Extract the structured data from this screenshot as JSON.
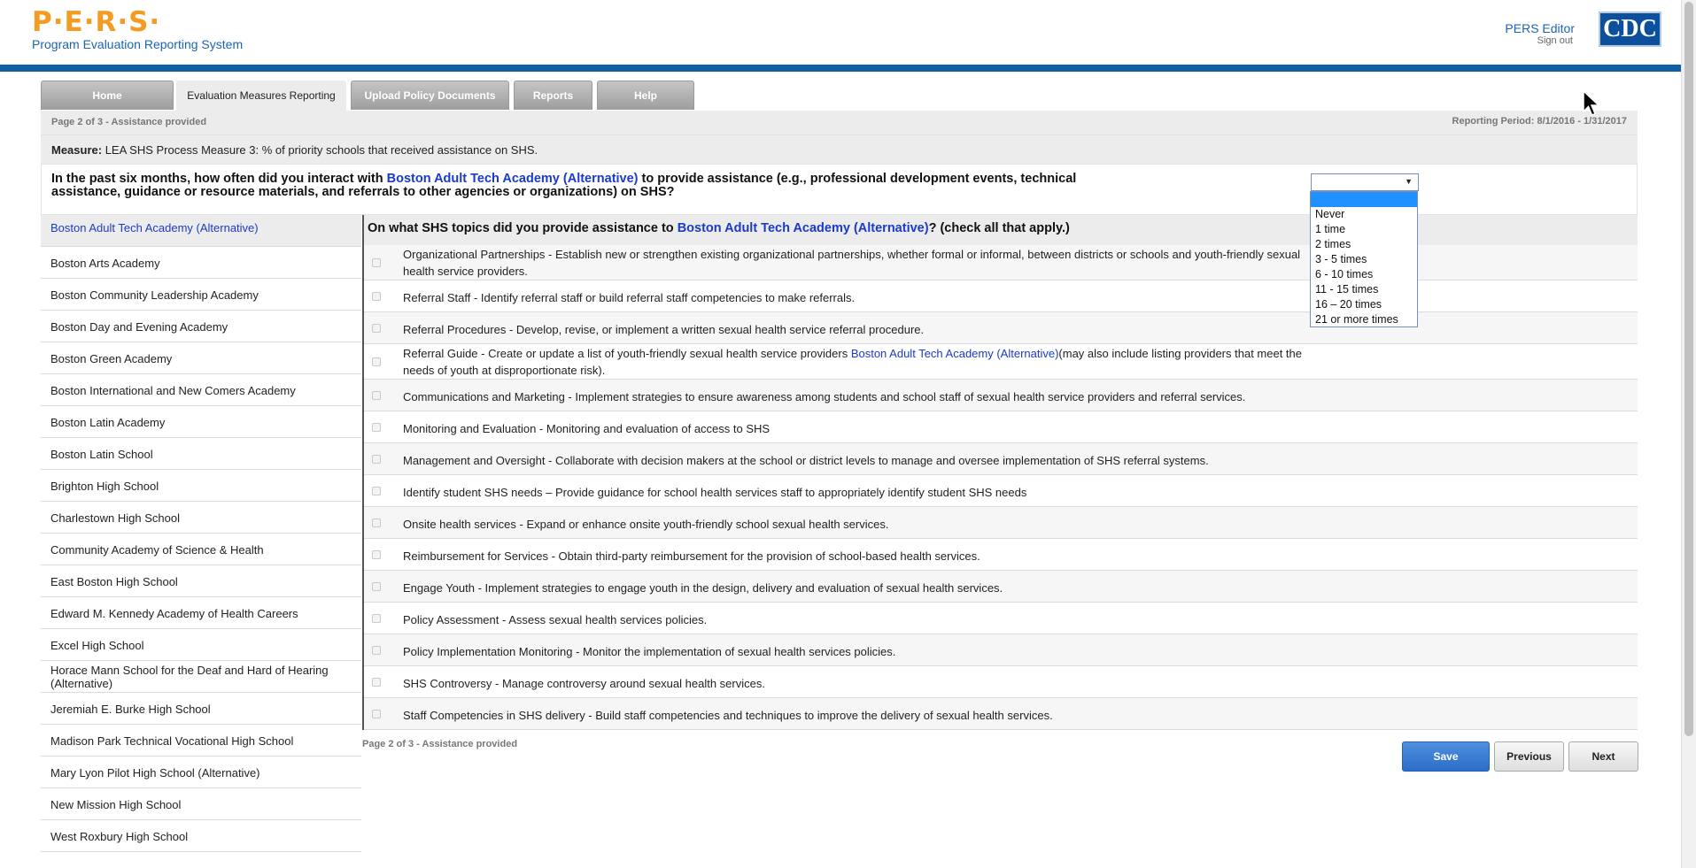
{
  "header": {
    "logo_letters": "P·E·R·S·",
    "logo_subtitle": "Program Evaluation Reporting System",
    "user_name": "PERS Editor",
    "sign_out": "Sign out",
    "cdc_logo_text": "CDC"
  },
  "tabs": [
    {
      "label": "Home"
    },
    {
      "label": "Evaluation Measures Reporting"
    },
    {
      "label": "Upload Policy Documents"
    },
    {
      "label": "Reports"
    },
    {
      "label": "Help"
    }
  ],
  "page_status": "Page 2 of 3 - Assistance provided",
  "reporting_period": "Reporting Period: 8/1/2016 - 1/31/2017",
  "measure": {
    "label": "Measure:",
    "text": "LEA SHS Process Measure 3: % of priority schools that received assistance on SHS."
  },
  "question": {
    "prefix": "In the past six months, how often did you interact with",
    "school": "Boston Adult Tech Academy (Alternative)",
    "suffix": "to provide assistance (e.g., professional development events, technical assistance, guidance or resource materials, and referrals to other agencies or organizations) on SHS?"
  },
  "frequency_select": {
    "selected": "",
    "options": [
      "",
      "Never",
      "1 time",
      "2 times",
      "3 - 5 times",
      "6 - 10 times",
      "11 - 15 times",
      "16 – 20 times",
      "21 or more times"
    ]
  },
  "schools": [
    "Boston Adult Tech Academy (Alternative)",
    "Boston Arts Academy",
    "Boston Community Leadership Academy",
    "Boston Day and Evening Academy",
    "Boston Green Academy",
    "Boston International and New Comers Academy",
    "Boston Latin Academy",
    "Boston Latin School",
    "Brighton High School",
    "Charlestown High School",
    "Community Academy of Science & Health",
    "East Boston High School",
    "Edward M. Kennedy Academy of Health Careers",
    "Excel High School",
    "Horace Mann School for the Deaf and Hard of Hearing (Alternative)",
    "Jeremiah E. Burke High School",
    "Madison Park Technical Vocational High School",
    "Mary Lyon Pilot High School (Alternative)",
    "New Mission High School",
    "West Roxbury High School"
  ],
  "topics_heading": {
    "prefix": "On what SHS topics did you provide assistance to",
    "school": "Boston Adult Tech Academy (Alternative)",
    "suffix": "? (check all that apply.)"
  },
  "topics": [
    {
      "text": "Organizational Partnerships - Establish new or strengthen existing organizational partnerships, whether formal or informal, between districts or schools and youth-friendly sexual health service providers."
    },
    {
      "text": "Referral Staff - Identify referral staff or build referral staff competencies to make referrals."
    },
    {
      "text": "Referral Procedures - Develop, revise, or implement a written sexual health service referral procedure."
    },
    {
      "text_before": "Referral Guide - Create or update a list of youth-friendly sexual health service providers ",
      "school": "Boston Adult Tech Academy (Alternative)",
      "text_after": "(may also include listing providers that meet the needs of youth at disproportionate risk)."
    },
    {
      "text": "Communications and Marketing - Implement strategies to ensure awareness among students and school staff of sexual health service providers and referral services."
    },
    {
      "text": "Monitoring and Evaluation - Monitoring and evaluation of access to SHS"
    },
    {
      "text": "Management and Oversight - Collaborate with decision makers at the school or district levels to manage and oversee implementation of SHS referral systems."
    },
    {
      "text": "Identify student SHS needs – Provide guidance for school health services staff to appropriately identify student SHS needs"
    },
    {
      "text": "Onsite health services - Expand or enhance onsite youth-friendly school sexual health services."
    },
    {
      "text": "Reimbursement for Services - Obtain third-party reimbursement for the provision of school-based health services."
    },
    {
      "text": "Engage Youth - Implement strategies to engage youth in the design, delivery and evaluation of sexual health services."
    },
    {
      "text": "Policy Assessment - Assess sexual health services policies."
    },
    {
      "text": "Policy Implementation Monitoring - Monitor the implementation of sexual health services policies."
    },
    {
      "text": "SHS Controversy - Manage controversy around sexual health services."
    },
    {
      "text": "Staff Competencies in SHS delivery - Build staff competencies and techniques to improve the delivery of sexual health services."
    }
  ],
  "buttons": {
    "save": "Save",
    "previous": "Previous",
    "next": "Next"
  },
  "colors": {
    "brand_orange": "#f39b23",
    "brand_blue": "#0e5fa6",
    "link_blue": "#1a3bc9",
    "save_blue": "#2c6ec9",
    "highlight": "#1e90ff"
  }
}
